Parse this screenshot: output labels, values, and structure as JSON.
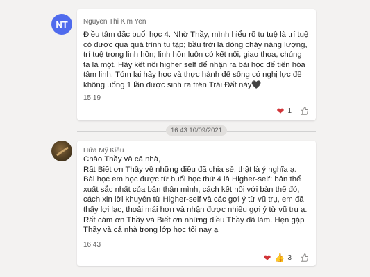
{
  "messages": [
    {
      "avatar_initials": "NT",
      "author": "Nguyen Thi Kim Yen",
      "paragraphs": [
        "Điều tâm đắc buổi học 4. Nhờ Thầy, mình hiểu rõ tu tuệ là trí tuệ có được qua quá trình tu tập; bầu trời là dòng chảy năng lượng, trí tuệ trong   linh hồn; linh hồn luôn có kết nối, giao thoa, chúng ta là một. Hãy kết nối higher self để nhận ra bài học để tiến hóa tâm linh. Tóm lại hãy học và thực hành để sống có nghị lực để không uổng 1 lần được sinh ra trên Trái Đất này🖤"
      ],
      "time": "15:19",
      "reaction_count": "1"
    },
    {
      "author": "Hứa Mỹ Kiều",
      "paragraphs": [
        "Chào Thầy và cả nhà,",
        "Rất Biết ơn Thầy về những điều đã chia sẻ, thật là ý nghĩa ạ.",
        "Bài học em học được từ buổi học thứ 4 là Higher-self: bản thể xuất sắc nhất của bản thân mình, cách kết nối với bản thể đó, cách xin lời khuyên từ Higher-self và các gợi ý từ vũ trụ, em đã thấy lợi lạc, thoải mái hơn và nhận được nhiều gợi ý từ vũ trụ ạ.",
        "Rất cám ơn Thầy và Biết ơn những điều Thầy đã làm. Hẹn gặp Thầy và cả nhà trong lớp học tối nay ạ"
      ],
      "time": "16:43",
      "reaction_count": "3"
    }
  ],
  "divider": {
    "label": "16:43 10/09/2021"
  },
  "icons": {
    "heart": "heart-icon",
    "like": "thumbs-up-icon"
  },
  "colors": {
    "background": "#f3f2f1",
    "card": "#ffffff",
    "avatar_nt": "#4f6bed",
    "heart": "#d13438"
  }
}
